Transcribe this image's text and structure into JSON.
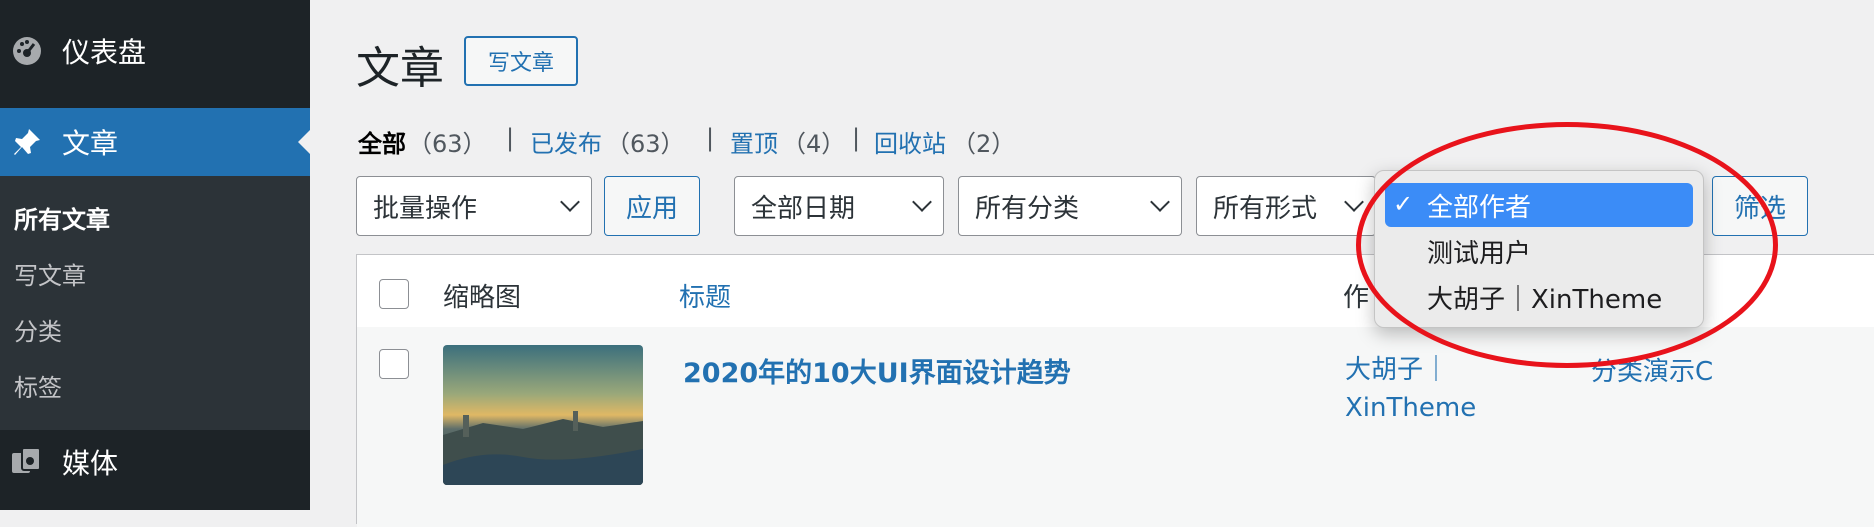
{
  "sidebar": {
    "dashboard_label": "仪表盘",
    "posts_label": "文章",
    "submenu": [
      "所有文章",
      "写文章",
      "分类",
      "标签"
    ],
    "media_label": "媒体"
  },
  "page": {
    "title": "文章",
    "add_new": "写文章"
  },
  "views": {
    "all_label": "全部",
    "all_count": "（63）",
    "published_label": "已发布",
    "published_count": "（63）",
    "sticky_label": "置顶",
    "sticky_count": "（4）",
    "trash_label": "回收站",
    "trash_count": "（2）",
    "separator": "|"
  },
  "filters": {
    "bulk_action": "批量操作",
    "apply": "应用",
    "dates": "全部日期",
    "categories": "所有分类",
    "formats": "所有形式",
    "filter_button": "筛选"
  },
  "author_dropdown": {
    "options": [
      "全部作者",
      "测试用户",
      "大胡子｜XinTheme"
    ],
    "selected_index": 0,
    "check": "✓"
  },
  "table": {
    "headers": {
      "thumbnail": "缩略图",
      "title": "标题",
      "author": "作"
    },
    "rows": [
      {
        "title": "2020年的10大UI界面设计趋势",
        "author_line1": "大胡子｜",
        "author_line2": "XinTheme",
        "category": "分类演示C"
      }
    ]
  },
  "colors": {
    "accent": "#2271b1",
    "sidebar_bg": "#1d2327",
    "highlight": "#e8131b",
    "dropdown_selected": "#3b8cf7"
  }
}
